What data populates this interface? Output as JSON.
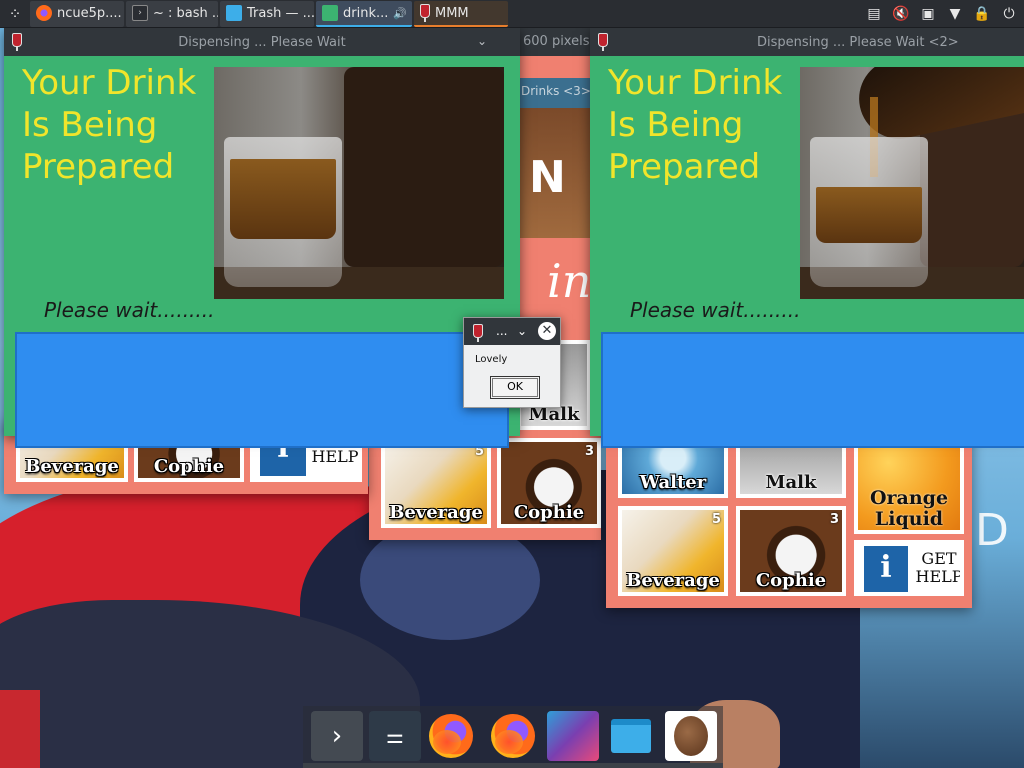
{
  "taskbar": {
    "launcher_icon": "kde-launcher-icon",
    "tasks": [
      {
        "label": "ncue5p....",
        "icon": "firefox-icon",
        "state": "normal"
      },
      {
        "label": "~ : bash ...",
        "icon": "terminal-icon",
        "state": "normal"
      },
      {
        "label": "Trash — ...",
        "icon": "folder-icon",
        "state": "normal"
      },
      {
        "label": "drink...",
        "icon": "drinks-app-icon",
        "state": "active",
        "extra_icon": "audio-playing-icon"
      },
      {
        "label": "MMM",
        "icon": "glass-icon",
        "state": "attention"
      }
    ],
    "tray": [
      "clipboard-icon",
      "speaker-muted-icon",
      "network-icon",
      "arrow-down-icon",
      "lock-icon",
      "power-icon"
    ]
  },
  "windows": {
    "dispensing_1": {
      "title": "Dispensing ... Please Wait",
      "heading": "Your Drink Is Being Prepared",
      "wait": "Please wait........."
    },
    "dispensing_2": {
      "title": "Dispensing ... Please Wait <2>",
      "heading": "Your Drink Is Being Prepared",
      "wait": "Please wait........."
    },
    "back_window_title_fragment": "600 pixels)",
    "drinks3_title": "Drinks <3>",
    "drinks3_banner_letters": "N"
  },
  "tiles": {
    "beverage": "Beverage",
    "cophie": "Cophie",
    "walter": "Walter",
    "malk": "Malk",
    "orange": "Orange Liquid",
    "help": "GET HELP",
    "help_icon": "i",
    "num_5": "5",
    "num_3": "3"
  },
  "dialog": {
    "title": "...",
    "message": "Lovely",
    "ok": "OK"
  },
  "dock": {
    "items": [
      "terminal-icon",
      "settings-icon",
      "firefox-icon",
      "firefox-icon",
      "krita-icon",
      "folder-icon",
      "coffee-bean-icon"
    ]
  },
  "colors": {
    "dispense_bg": "#3cb371",
    "heading_text": "#f1e52b",
    "progress_area": "#2f8df0",
    "drinks_bg": "#f08070",
    "active_task": "#3daee9"
  },
  "desktop": {
    "letter_fragment": "D"
  }
}
